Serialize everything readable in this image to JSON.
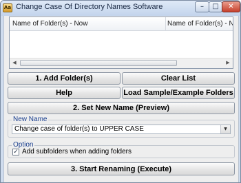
{
  "window": {
    "title": "Change Case Of Directory Names Software",
    "icon": "app-icon",
    "controls": {
      "minimize": "–",
      "maximize": "□",
      "close": "✕"
    }
  },
  "list": {
    "columns": [
      "Name of Folder(s) - Now",
      "Name of Folder(s) - New Na"
    ],
    "rows": []
  },
  "buttons": {
    "add_folders": "1. Add Folder(s)",
    "clear_list": "Clear List",
    "help": "Help",
    "load_sample": "Load Sample/Example Folders",
    "set_new_name": "2. Set New Name (Preview)",
    "start_renaming": "3. Start Renaming (Execute)"
  },
  "new_name": {
    "legend": "New Name",
    "selected": "Change case of folder(s) to UPPER CASE"
  },
  "option": {
    "legend": "Option",
    "add_subfolders_label": "Add subfolders when adding folders",
    "add_subfolders_checked": true
  },
  "colors": {
    "legend_text": "#1a3f8f",
    "window_frame": "#cfdcee",
    "panel_background": "#eeeeee"
  }
}
